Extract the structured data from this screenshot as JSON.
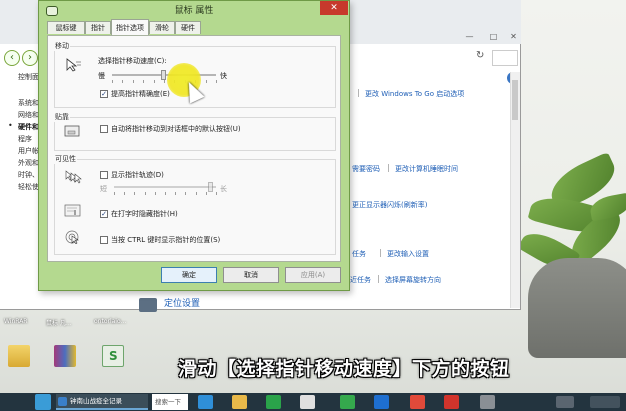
{
  "control_panel": {
    "sidebar": [
      "控制面",
      "系统和",
      "网络和",
      "硬件和",
      "程序",
      "用户帐",
      "外观和",
      "时钟、",
      "轻松使"
    ],
    "links": {
      "windows_to_go": "更改 Windows To Go 启动选项",
      "password": "需要密码",
      "sleep": "更改计算机睡眠时间",
      "refresh_rate": "更正显示器闪烁(刷新率)",
      "task": "任务",
      "input": "更改输入设置",
      "task2": "近任务",
      "rotation": "选择屏幕旋转方向"
    },
    "section": "定位设置"
  },
  "dialog": {
    "title": "鼠标 属性",
    "close": "✕",
    "tabs": [
      "鼠标键",
      "指针",
      "指针选项",
      "滑轮",
      "硬件"
    ],
    "active_tab_index": 2,
    "motion": {
      "group_label": "移动",
      "speed_label": "选择指针移动速度(C):",
      "slow": "慢",
      "fast": "快",
      "speed_value_fraction": 0.5,
      "enhance_label": "提高指针精确度(E)",
      "enhance_checked": true
    },
    "snap": {
      "group_label": "贴靠",
      "label": "自动将指针移动到对话框中的默认按钮(U)",
      "checked": false
    },
    "visibility": {
      "group_label": "可见性",
      "trails_label": "显示指针轨迹(D)",
      "trails_checked": false,
      "short": "短",
      "long": "长",
      "trails_value_fraction": 0.95,
      "hide_label": "在打字时隐藏指针(H)",
      "hide_checked": true,
      "ctrl_label": "当按 CTRL 键时显示指针的位置(S)",
      "ctrl_checked": false
    },
    "buttons": {
      "ok": "确定",
      "cancel": "取消",
      "apply": "应用(A)"
    }
  },
  "desktop_icons": [
    {
      "label": "WinRAR",
      "icon": "winrar-icon"
    },
    {
      "label": "鼠标 凡...",
      "icon": "folder-icon"
    },
    {
      "label": "ontorlaio...",
      "icon": "file-icon"
    },
    {
      "label": "",
      "icon": "folder-icon"
    },
    {
      "label": "",
      "icon": "winrar-icon"
    },
    {
      "label": "",
      "icon": "spreadsheet-icon"
    }
  ],
  "caption": "滑动【选择指针移动速度】下方的按钮",
  "taskbar": {
    "item1": "钟南山战疫全记录",
    "search_placeholder": "搜索一下"
  },
  "colors": {
    "dialog_frame": "#b4d98f",
    "link": "#1f5fb6",
    "highlight": "#f0ec28",
    "taskbar": "#23343f"
  }
}
